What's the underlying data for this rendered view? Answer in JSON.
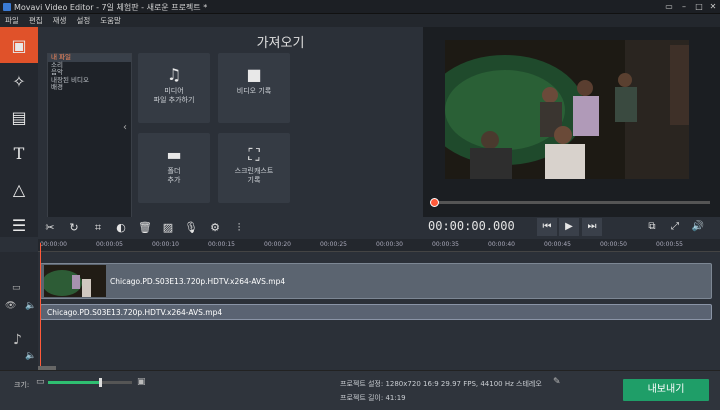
{
  "window": {
    "title": "Movavi Video Editor - 7일 체험판 - 새로운 프로젝트 *"
  },
  "menu": [
    "파일",
    "편집",
    "재생",
    "설정",
    "도움말"
  ],
  "sidebar_tools": [
    {
      "icon": "film-import-icon",
      "active": true
    },
    {
      "icon": "magic-wand-icon",
      "active": false
    },
    {
      "icon": "filter-icon",
      "active": false
    },
    {
      "icon": "text-icon",
      "active": false
    },
    {
      "icon": "shapes-icon",
      "active": false
    },
    {
      "icon": "menu-list-icon",
      "active": false
    }
  ],
  "import_panel": {
    "title": "가져오기",
    "tree": [
      "내 파일",
      "소리",
      "음악",
      "내장된 비디오",
      "배경"
    ],
    "tiles": [
      {
        "name": "add-media-tile",
        "label": "미디어\n파일 추가하기"
      },
      {
        "name": "record-video-tile",
        "label": "비디오 기록"
      },
      {
        "name": "add-folder-tile",
        "label": "폴더\n추가"
      },
      {
        "name": "screencast-tile",
        "label": "스크린캐스트\n기록"
      }
    ]
  },
  "player": {
    "timecode": "00:00:00.000",
    "progress": 0
  },
  "timeline": {
    "ruler": [
      "00:00:00",
      "00:00:05",
      "00:00:10",
      "00:00:15",
      "00:00:20",
      "00:00:25",
      "00:00:30",
      "00:00:35",
      "00:00:40",
      "00:00:45",
      "00:00:50",
      "00:00:55"
    ],
    "video_clip": "Chicago.PD.S03E13.720p.HDTV.x264-AVS.mp4",
    "audio_clip": "Chicago.PD.S03E13.720p.HDTV.x264-AVS.mp4"
  },
  "bottom": {
    "zoom_label": "크기:",
    "zoom_value": 0.62,
    "project_settings": "프로젝트 설정:  1280x720 16:9 29.97 FPS, 44100 Hz 스테레오",
    "project_length": "프로젝트 길이:  41:19",
    "export_label": "내보내기"
  },
  "colors": {
    "accent": "#e0522a",
    "export": "#1f9e68",
    "playhead": "#ff5a3a"
  }
}
